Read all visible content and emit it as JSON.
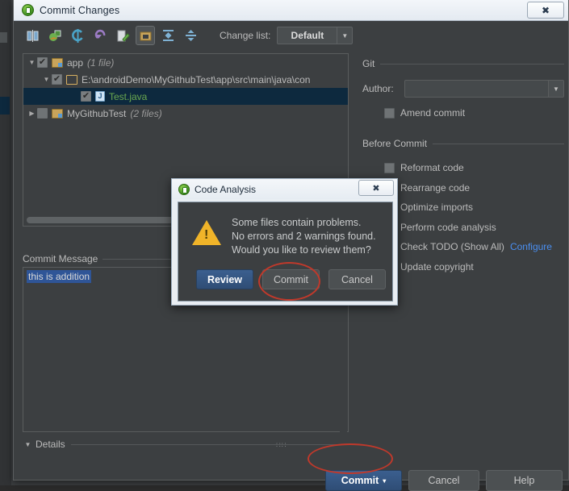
{
  "window": {
    "title": "Commit Changes",
    "close_label": "✖",
    "app_icon": "intellij-idea-icon"
  },
  "toolbar": {
    "buttons": [
      {
        "name": "show-diff-icon",
        "glyph": "⚖"
      },
      {
        "name": "revert-selected-icon",
        "glyph": "❖"
      },
      {
        "name": "refresh-changes-icon",
        "glyph": "↻"
      },
      {
        "name": "rollback-icon",
        "glyph": "↶"
      },
      {
        "name": "edit-source-icon",
        "glyph": "✎"
      },
      {
        "name": "group-by-directory-icon",
        "glyph": "▣",
        "pressed": true
      },
      {
        "name": "expand-all-icon",
        "glyph": "⬍"
      },
      {
        "name": "collapse-all-icon",
        "glyph": "⬌"
      }
    ],
    "changelist_label": "Change list:",
    "changelist_value": "Default",
    "changelist_caret": "▼"
  },
  "tree": {
    "rows": [
      {
        "name": "tree-row-app",
        "indent": 4,
        "twisty": "▼",
        "checked": true,
        "icon": "folder-module-icon",
        "label": "app",
        "count": "(1 file)",
        "selected": false,
        "green": false
      },
      {
        "name": "tree-row-path",
        "indent": 22,
        "twisty": "▼",
        "checked": true,
        "icon": "folder-icon",
        "label": "E:\\androidDemo\\MyGithubTest\\app\\src\\main\\java\\con",
        "count": "",
        "selected": false,
        "green": false
      },
      {
        "name": "tree-row-testjava",
        "indent": 58,
        "twisty": "",
        "checked": true,
        "icon": "java-file-icon",
        "label": "Test.java",
        "count": "",
        "selected": true,
        "green": true
      },
      {
        "name": "tree-row-mygithubtest",
        "indent": 4,
        "twisty": "▶",
        "checked": false,
        "icon": "folder-module-icon",
        "label": "MyGithubTest",
        "count": "(2 files)",
        "selected": false,
        "green": false
      }
    ]
  },
  "commit_message": {
    "header": "Commit Message",
    "header_mnemonic": "C",
    "value": "this is addition"
  },
  "details": {
    "label": "Details",
    "twisty": "▼",
    "grip": "∷∷"
  },
  "git_group": {
    "title": "Git",
    "author_label": "Author:",
    "author_value": "",
    "author_caret": "▼",
    "amend_label": "Amend commit",
    "amend_checked": false
  },
  "before_commit": {
    "title": "Before Commit",
    "options": [
      {
        "name": "reformat-code-option",
        "label": "Reformat code",
        "checked": false,
        "link": ""
      },
      {
        "name": "rearrange-code-option",
        "label": "Rearrange code",
        "checked": false,
        "link": ""
      },
      {
        "name": "optimize-imports-option",
        "label": "Optimize imports",
        "checked": false,
        "link": ""
      },
      {
        "name": "perform-code-analysis-option",
        "label": "Perform code analysis",
        "checked": false,
        "link": ""
      },
      {
        "name": "check-todo-option",
        "label": "Check TODO (Show All)",
        "checked": false,
        "link": "Configure"
      },
      {
        "name": "update-copyright-option",
        "label": "Update copyright",
        "checked": false,
        "link": ""
      }
    ]
  },
  "footer": {
    "commit_label": "Commit",
    "commit_caret": "▾",
    "cancel_label": "Cancel",
    "help_label": "Help"
  },
  "modal": {
    "title": "Code Analysis",
    "close_label": "✖",
    "icon": "warning-triangle-icon",
    "message_line1": "Some files contain problems.",
    "message_line2": "No errors and 2 warnings found.",
    "message_line3": "Would you like to review them?",
    "buttons": {
      "review": "Review",
      "commit": "Commit",
      "cancel": "Cancel"
    }
  },
  "annotations": {
    "accent_color": "#c0392b",
    "ellipse_bottom_commit": "highlight-around-bottom-commit-button",
    "ellipse_modal_commit": "highlight-around-modal-commit-button"
  }
}
